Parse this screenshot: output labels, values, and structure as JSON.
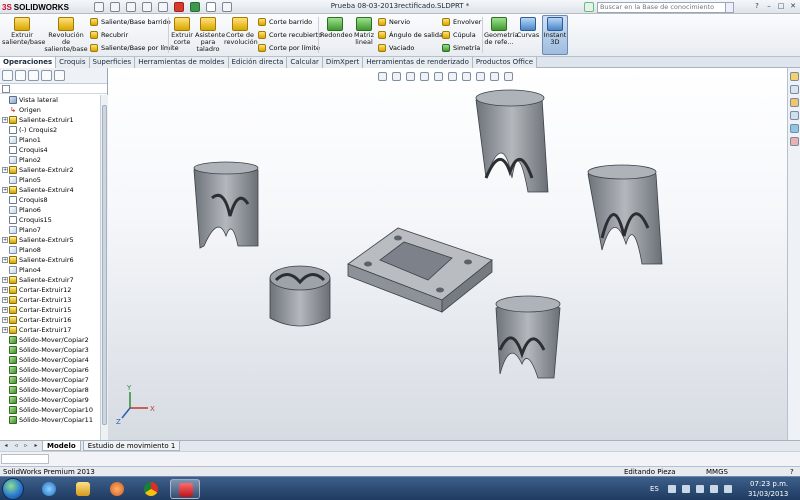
{
  "titlebar": {
    "app_name": "SOLIDWORKS",
    "app_logo_prefix": "3S",
    "document_title": "Prueba 08-03-2013rectificado.SLDPRT *",
    "search_placeholder": "Buscar en la Base de conocimiento",
    "window_controls": [
      "?",
      "–",
      "□",
      "✕"
    ]
  },
  "ribbon": {
    "large_buttons": [
      {
        "label": "Extruir saliente/base",
        "icon": "extrude-icon",
        "color": "#f1c232"
      },
      {
        "label": "Revolución de saliente/base",
        "icon": "revolve-icon",
        "color": "#f1c232"
      },
      {
        "label": "Extruir corte",
        "icon": "extrude-cut-icon",
        "color": "#f1c232"
      },
      {
        "label": "Asistente para taladro",
        "icon": "hole-wizard-icon",
        "color": "#f1c232"
      },
      {
        "label": "Corte de revolución",
        "icon": "revolve-cut-icon",
        "color": "#f1c232"
      },
      {
        "label": "Redondeo",
        "icon": "fillet-icon",
        "color": "#3b9a4b"
      },
      {
        "label": "Matriz lineal",
        "icon": "linear-pattern-icon",
        "color": "#3b9a4b"
      },
      {
        "label": "Geometría de refe...",
        "icon": "reference-geometry-icon",
        "color": "#3b9a4b"
      },
      {
        "label": "Curvas",
        "icon": "curves-icon",
        "color": "#4b86c7"
      },
      {
        "label": "Instant 3D",
        "icon": "instant3d-icon",
        "color": "#4b86c7"
      }
    ],
    "small_buttons": [
      {
        "label": "Saliente/Base barrido",
        "icon": "sweep-icon"
      },
      {
        "label": "Recubrir",
        "icon": "loft-icon"
      },
      {
        "label": "Saliente/Base por límite",
        "icon": "boundary-icon"
      },
      {
        "label": "Corte barrido",
        "icon": "sweep-cut-icon"
      },
      {
        "label": "Corte recubierto",
        "icon": "loft-cut-icon"
      },
      {
        "label": "Corte por límite",
        "icon": "boundary-cut-icon"
      },
      {
        "label": "Nervio",
        "icon": "rib-icon"
      },
      {
        "label": "Ángulo de salida",
        "icon": "draft-icon"
      },
      {
        "label": "Vaciado",
        "icon": "shell-icon"
      },
      {
        "label": "Envolver",
        "icon": "wrap-icon"
      },
      {
        "label": "Cúpula",
        "icon": "dome-icon"
      },
      {
        "label": "Simetría",
        "icon": "mirror-icon"
      }
    ]
  },
  "tabs": [
    "Operaciones",
    "Croquis",
    "Superficies",
    "Herramientas de moldes",
    "Edición directa",
    "Calcular",
    "DimXpert",
    "Herramientas de renderizado",
    "Productos Office"
  ],
  "active_tab": "Operaciones",
  "tree": {
    "items": [
      {
        "label": "Vista lateral",
        "icon": "vista",
        "expand": false
      },
      {
        "label": "Origen",
        "icon": "origen",
        "expand": false
      },
      {
        "label": "Saliente-Extruir1",
        "icon": "ext",
        "expand": true
      },
      {
        "label": "(-) Croquis2",
        "icon": "sketch",
        "expand": false
      },
      {
        "label": "Plano1",
        "icon": "plane",
        "expand": false
      },
      {
        "label": "Croquis4",
        "icon": "sketch",
        "expand": false
      },
      {
        "label": "Plano2",
        "icon": "plane",
        "expand": false
      },
      {
        "label": "Saliente-Extruir2",
        "icon": "ext",
        "expand": true
      },
      {
        "label": "Plano5",
        "icon": "plane",
        "expand": false
      },
      {
        "label": "Saliente-Extruir4",
        "icon": "ext",
        "expand": true
      },
      {
        "label": "Croquis8",
        "icon": "sketch",
        "expand": false
      },
      {
        "label": "Plano6",
        "icon": "plane",
        "expand": false
      },
      {
        "label": "Croquis15",
        "icon": "sketch",
        "expand": false
      },
      {
        "label": "Plano7",
        "icon": "plane",
        "expand": false
      },
      {
        "label": "Saliente-Extruir5",
        "icon": "ext",
        "expand": true
      },
      {
        "label": "Plano8",
        "icon": "plane",
        "expand": false
      },
      {
        "label": "Saliente-Extruir6",
        "icon": "ext",
        "expand": true
      },
      {
        "label": "Plano4",
        "icon": "plane",
        "expand": false
      },
      {
        "label": "Saliente-Extruir7",
        "icon": "ext",
        "expand": true
      },
      {
        "label": "Cortar-Extruir12",
        "icon": "cut",
        "expand": true
      },
      {
        "label": "Cortar-Extruir13",
        "icon": "cut",
        "expand": true
      },
      {
        "label": "Cortar-Extruir15",
        "icon": "cut",
        "expand": true
      },
      {
        "label": "Cortar-Extruir16",
        "icon": "cut",
        "expand": true
      },
      {
        "label": "Cortar-Extruir17",
        "icon": "cut",
        "expand": true
      },
      {
        "label": "Sólido-Mover/Copiar2",
        "icon": "move",
        "expand": false
      },
      {
        "label": "Sólido-Mover/Copiar3",
        "icon": "move",
        "expand": false
      },
      {
        "label": "Sólido-Mover/Copiar4",
        "icon": "move",
        "expand": false
      },
      {
        "label": "Sólido-Mover/Copiar6",
        "icon": "move",
        "expand": false
      },
      {
        "label": "Sólido-Mover/Copiar7",
        "icon": "move",
        "expand": false
      },
      {
        "label": "Sólido-Mover/Copiar8",
        "icon": "move",
        "expand": false
      },
      {
        "label": "Sólido-Mover/Copiar9",
        "icon": "move",
        "expand": false
      },
      {
        "label": "Sólido-Mover/Copiar10",
        "icon": "move",
        "expand": false
      },
      {
        "label": "Sólido-Mover/Copiar11",
        "icon": "move",
        "expand": false
      }
    ]
  },
  "triad": {
    "x": "X",
    "y": "Y",
    "z": "Z"
  },
  "bottom_tabs": [
    "Modelo",
    "Estudio de movimiento 1"
  ],
  "status": {
    "product": "SolidWorks Premium 2013",
    "mode": "Editando Pieza",
    "units": "MMGS",
    "help": "?"
  },
  "taskbar": {
    "language": "ES",
    "time": "07:23 p.m.",
    "date": "31/03/2013"
  },
  "colors": {
    "part": "#8e939a",
    "accent_red": "#c8102e"
  }
}
